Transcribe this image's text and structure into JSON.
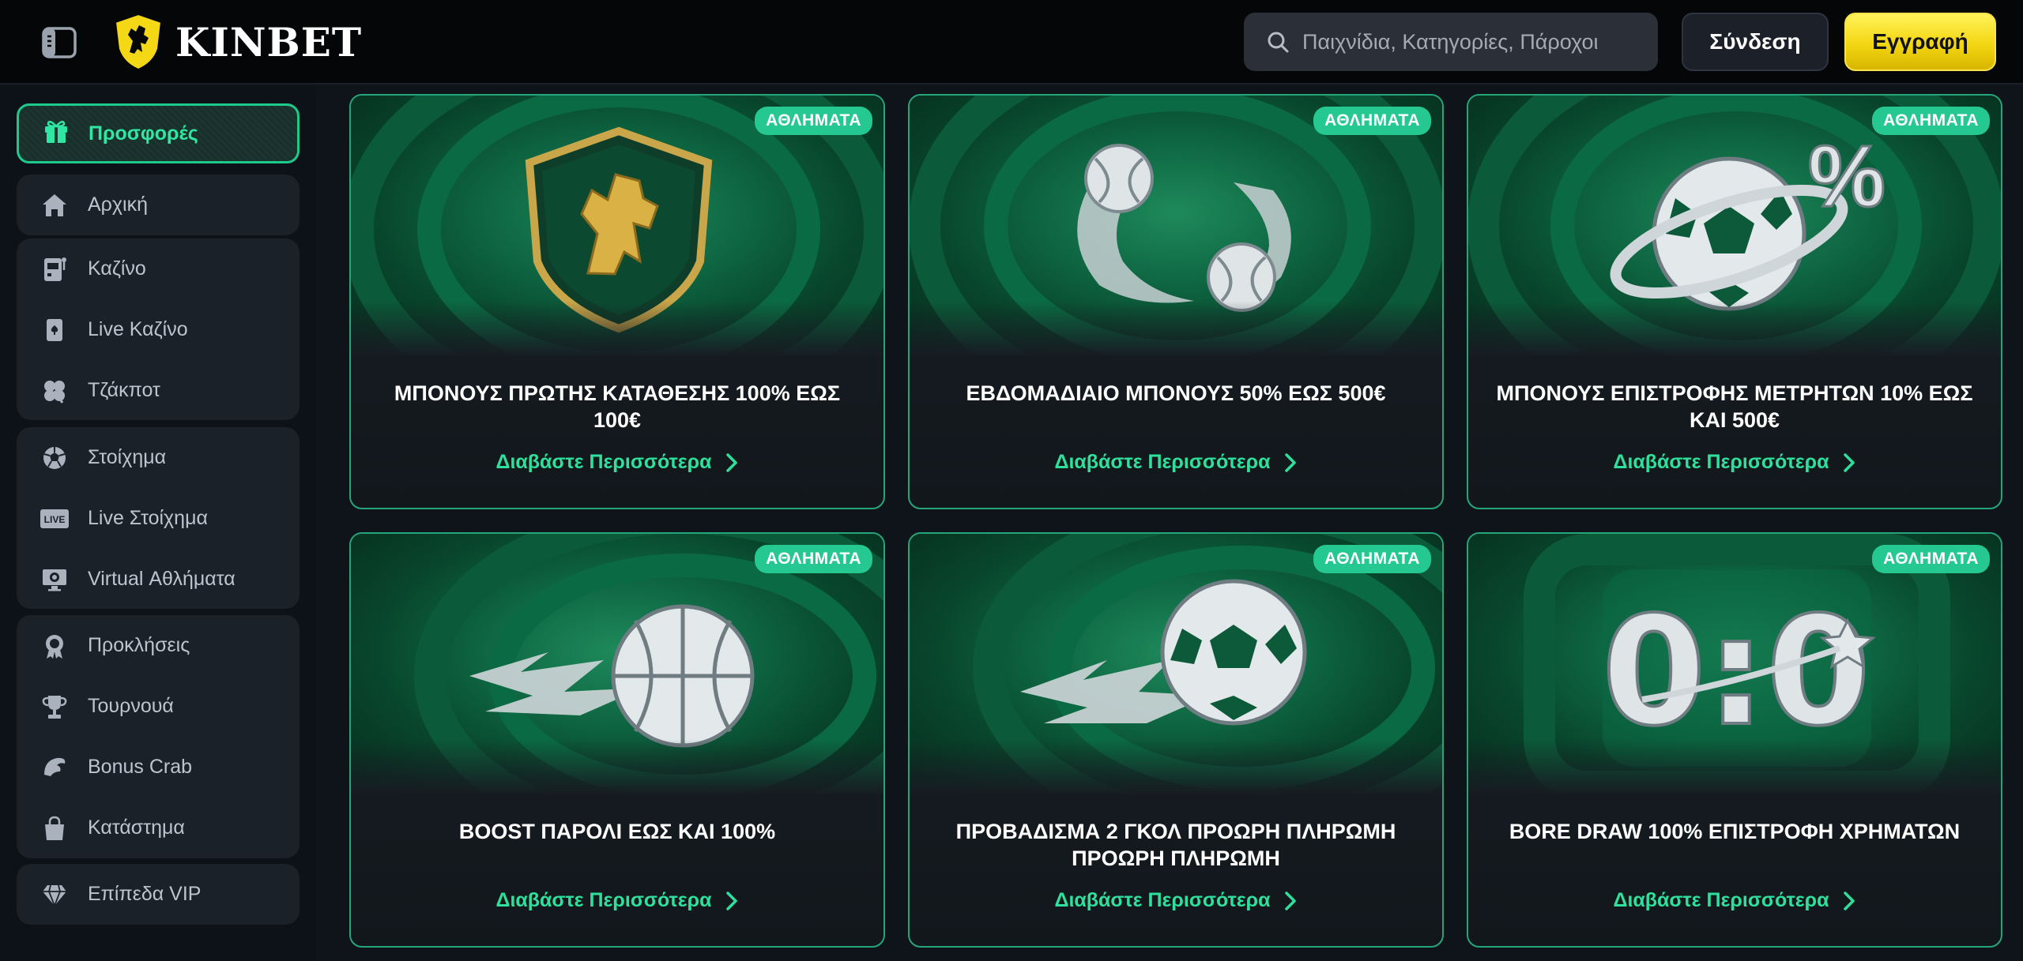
{
  "header": {
    "logo_text": "KINBET",
    "search_placeholder": "Παιχνίδια, Κατηγορίες, Πάροχοι",
    "login_label": "Σύνδεση",
    "register_label": "Εγγραφή"
  },
  "sidebar": {
    "promotions": "Προσφορές",
    "home": "Αρχική",
    "casino": "Καζίνο",
    "live_casino": "Live Καζίνο",
    "jackpot": "Τζάκποτ",
    "betting": "Στοίχημα",
    "live_betting": "Live Στοίχημα",
    "virtual_sports": "Virtual Αθλήματα",
    "challenges": "Προκλήσεις",
    "tournaments": "Τουρνουά",
    "bonus_crab": "Bonus Crab",
    "shop": "Κατάστημα",
    "vip_levels": "Επίπεδα VIP"
  },
  "cards": [
    {
      "badge": "ΑΘΛΗΜΑΤΑ",
      "title": "ΜΠΟΝΟΥΣ ΠΡΩΤΗΣ ΚΑΤΑΘΕΣΗΣ 100% ΕΩΣ 100€",
      "link": "Διαβάστε Περισσότερα",
      "art": "lion-shield"
    },
    {
      "badge": "ΑΘΛΗΜΑΤΑ",
      "title": "ΕΒΔΟΜΑΔΙΑΙΟ ΜΠΟΝΟΥΣ 50% ΕΩΣ 500€",
      "link": "Διαβάστε Περισσότερα",
      "art": "tennis-balls"
    },
    {
      "badge": "ΑΘΛΗΜΑΤΑ",
      "title": "ΜΠΟΝΟΥΣ ΕΠΙΣΤΡΟΦΗΣ ΜΕΤΡΗΤΩΝ 10% ΕΩΣ ΚΑΙ 500€",
      "link": "Διαβάστε Περισσότερα",
      "art": "football-percent"
    },
    {
      "badge": "ΑΘΛΗΜΑΤΑ",
      "title": "BOOST ΠΑΡΟΛΙ ΕΩΣ ΚΑΙ 100%",
      "link": "Διαβάστε Περισσότερα",
      "art": "basketball"
    },
    {
      "badge": "ΑΘΛΗΜΑΤΑ",
      "title": "ΠΡΟΒΑΔΙΣΜΑ 2 ΓΚΟΛ ΠΡΟΩΡΗ ΠΛΗΡΩΜΗ ΠΡΟΩΡΗ ΠΛΗΡΩΜΗ",
      "link": "Διαβάστε Περισσότερα",
      "art": "football-fire"
    },
    {
      "badge": "ΑΘΛΗΜΑΤΑ",
      "title": "BORE DRAW 100% ΕΠΙΣΤΡΟΦΗ ΧΡΗΜΑΤΩΝ",
      "link": "Διαβάστε Περισσότερα",
      "art": "zero-zero"
    }
  ]
}
